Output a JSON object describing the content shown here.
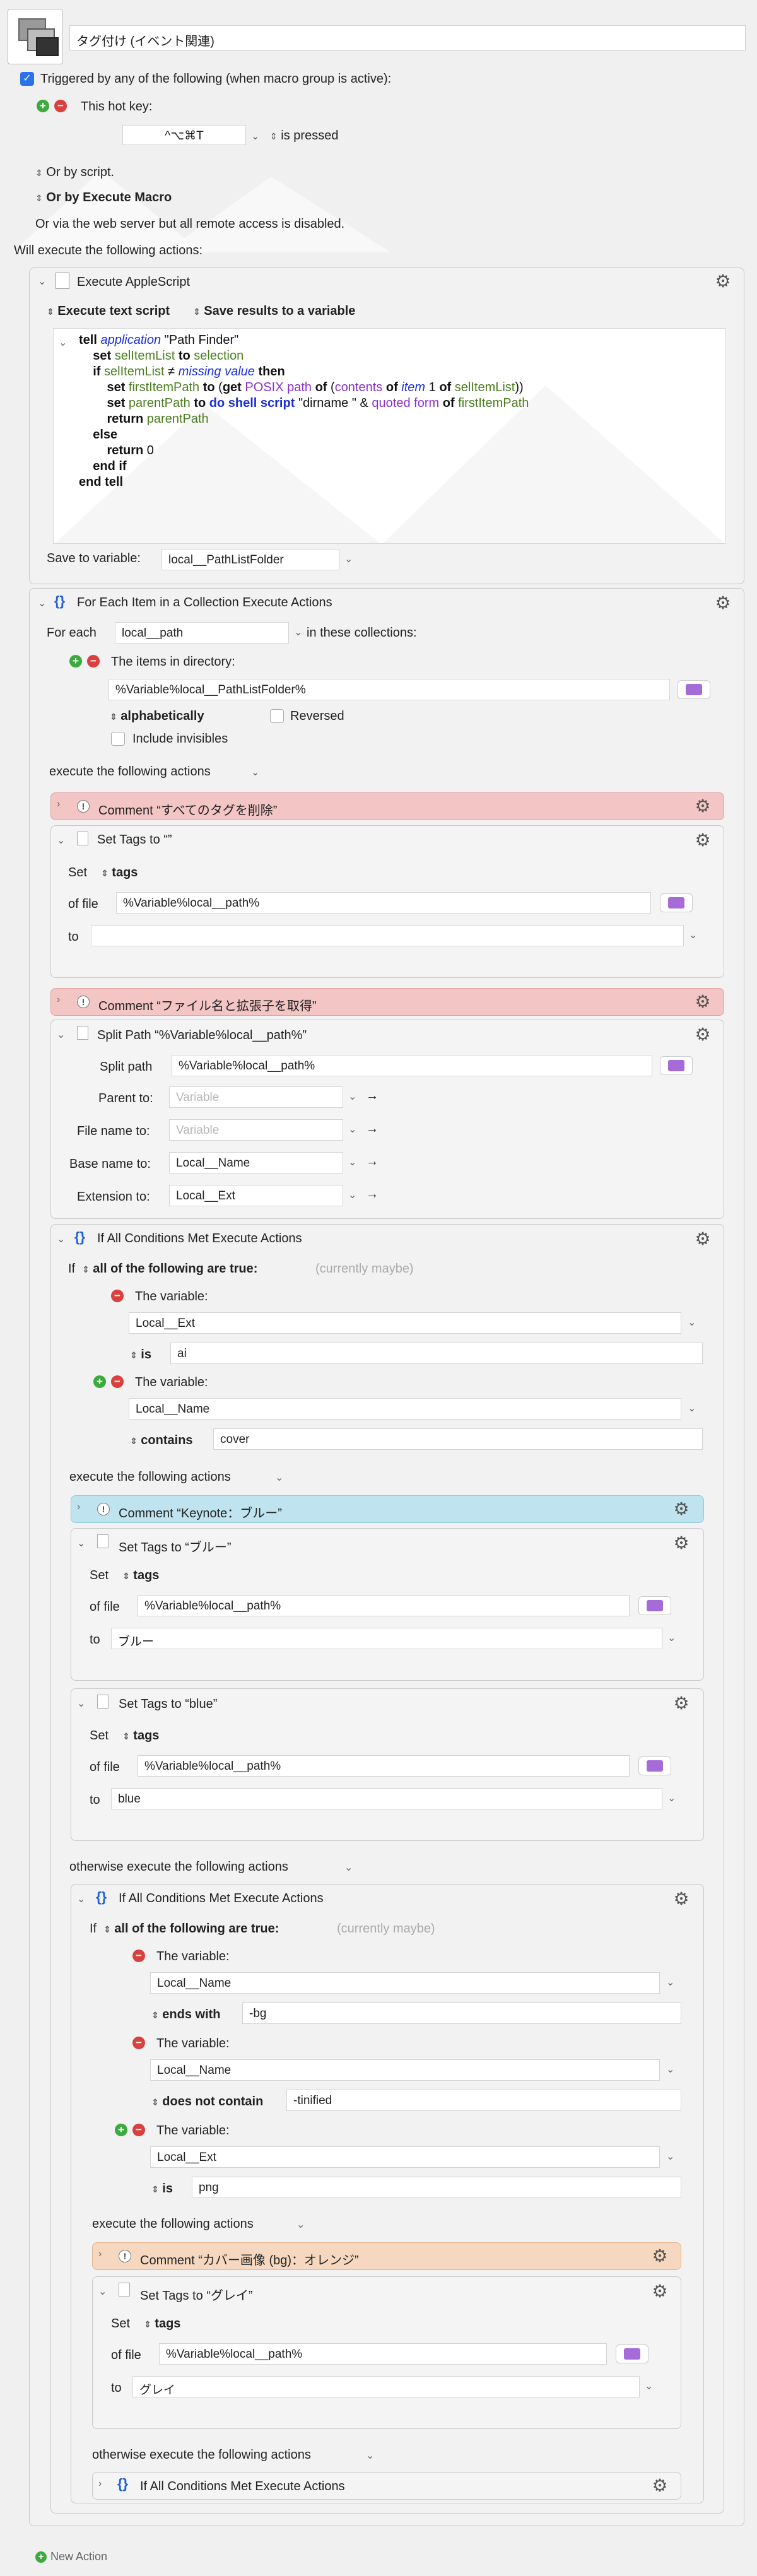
{
  "macro": {
    "title": "タグ付け (イベント関連)",
    "trigger_label": "Triggered by any of the following (when macro group is active):",
    "hotkey_label": "This hot key:",
    "hotkey_value": "^⌥⌘T",
    "hotkey_state": "is pressed",
    "or_by_script": "Or by script.",
    "or_by_execute_macro": "Or by Execute Macro",
    "web_server_note": "Or via the web server but all remote access is disabled.",
    "will_execute": "Will execute the following actions:",
    "new_action": "New Action"
  },
  "applescript": {
    "title": "Execute AppleScript",
    "mode": "Execute text script",
    "results": "Save results to a variable",
    "code": [
      [
        [
          "kw",
          "tell "
        ],
        [
          "app",
          "application "
        ],
        [
          "str",
          "\"Path Finder\""
        ]
      ],
      [
        [
          "sp",
          "    "
        ],
        [
          "kw",
          "set "
        ],
        [
          "var",
          "selItemList "
        ],
        [
          "kw",
          "to "
        ],
        [
          "var",
          "selection"
        ]
      ],
      [
        [
          "sp",
          "    "
        ],
        [
          "kw",
          "if "
        ],
        [
          "var",
          "selItemList "
        ],
        [
          "str",
          "≠ "
        ],
        [
          "app",
          "missing value "
        ],
        [
          "kw",
          "then"
        ]
      ],
      [
        [
          "sp",
          "        "
        ],
        [
          "kw",
          "set "
        ],
        [
          "var",
          "firstItemPath "
        ],
        [
          "kw",
          "to "
        ],
        [
          "str",
          "("
        ],
        [
          "kw",
          "get "
        ],
        [
          "prop",
          "POSIX path "
        ],
        [
          "kw",
          "of "
        ],
        [
          "str",
          "("
        ],
        [
          "prop",
          "contents "
        ],
        [
          "kw",
          "of "
        ],
        [
          "app",
          "item "
        ],
        [
          "str",
          "1 "
        ],
        [
          "kw",
          "of "
        ],
        [
          "var",
          "selItemList"
        ],
        [
          "str",
          "))"
        ]
      ],
      [
        [
          "sp",
          "        "
        ],
        [
          "kw",
          "set "
        ],
        [
          "var",
          "parentPath "
        ],
        [
          "kw",
          "to "
        ],
        [
          "cmd",
          "do shell script "
        ],
        [
          "str",
          "\"dirname \" & "
        ],
        [
          "prop",
          "quoted form "
        ],
        [
          "kw",
          "of "
        ],
        [
          "var",
          "firstItemPath"
        ]
      ],
      [
        [
          "sp",
          "        "
        ],
        [
          "kw",
          "return "
        ],
        [
          "var",
          "parentPath"
        ]
      ],
      [
        [
          "sp",
          "    "
        ],
        [
          "kw",
          "else"
        ]
      ],
      [
        [
          "sp",
          "        "
        ],
        [
          "kw",
          "return "
        ],
        [
          "str",
          "0"
        ]
      ],
      [
        [
          "sp",
          "    "
        ],
        [
          "kw",
          "end if"
        ]
      ],
      [
        [
          "kw",
          "end tell"
        ]
      ]
    ],
    "save_label": "Save to variable:",
    "save_var": "local__PathListFolder"
  },
  "foreach": {
    "title": "For Each Item in a Collection Execute Actions",
    "for_each": "For each",
    "var": "local__path",
    "in_collections": "in these collections:",
    "items_in_dir": "The items in directory:",
    "dir_value": "%Variable%local__PathListFolder%",
    "sort": "alphabetically",
    "reversed": "Reversed",
    "include_invisibles": "Include invisibles",
    "execute_following": "execute the following actions"
  },
  "comment1": "Comment “すべてのタグを削除”",
  "settags1": {
    "title": "Set Tags to “”",
    "set": "Set",
    "tags": "tags",
    "of_file": "of file",
    "file": "%Variable%local__path%",
    "to": "to",
    "to_value": ""
  },
  "comment2": "Comment “ファイル名と拡張子を取得”",
  "split": {
    "title": "Split Path “%Variable%local__path%”",
    "split_path_label": "Split path",
    "split_path_value": "%Variable%local__path%",
    "parent_label": "Parent to:",
    "parent_ph": "Variable",
    "filename_label": "File name to:",
    "filename_ph": "Variable",
    "basename_label": "Base name to:",
    "basename_value": "Local__Name",
    "ext_label": "Extension to:",
    "ext_value": "Local__Ext"
  },
  "if1": {
    "title": "If All Conditions Met Execute Actions",
    "if": "If",
    "all_true": "all of the following are true:",
    "currently": "(currently maybe)",
    "var_label": "The variable:",
    "c1_var": "Local__Ext",
    "c1_op": "is",
    "c1_val": "ai",
    "c2_var": "Local__Name",
    "c2_op": "contains",
    "c2_val": "cover",
    "execute_following": "execute the following actions",
    "comment": "Comment “Keynote：ブルー”",
    "tags_a_title": "Set Tags to “ブルー”",
    "tags_a_to": "ブルー",
    "tags_b_title": "Set Tags to “blue”",
    "tags_b_to": "blue",
    "otherwise": "otherwise execute the following actions"
  },
  "if2": {
    "title": "If All Conditions Met Execute Actions",
    "if": "If",
    "all_true": "all of the following are true:",
    "currently": "(currently maybe)",
    "var_label": "The variable:",
    "c1_var": "Local__Name",
    "c1_op": "ends with",
    "c1_val": "-bg",
    "c2_var": "Local__Name",
    "c2_op": "does not contain",
    "c2_val": "-tinified",
    "c3_var": "Local__Ext",
    "c3_op": "is",
    "c3_val": "png",
    "execute_following": "execute the following actions",
    "comment": "Comment “カバー画像 (bg)：オレンジ”",
    "tags_title": "Set Tags to “グレイ”",
    "tags_to": "グレイ",
    "otherwise": "otherwise execute the following actions",
    "nested_if": "If All Conditions Met Execute Actions"
  },
  "common": {
    "set": "Set",
    "tags": "tags",
    "of_file": "of file",
    "file": "%Variable%local__path%",
    "to": "to"
  }
}
